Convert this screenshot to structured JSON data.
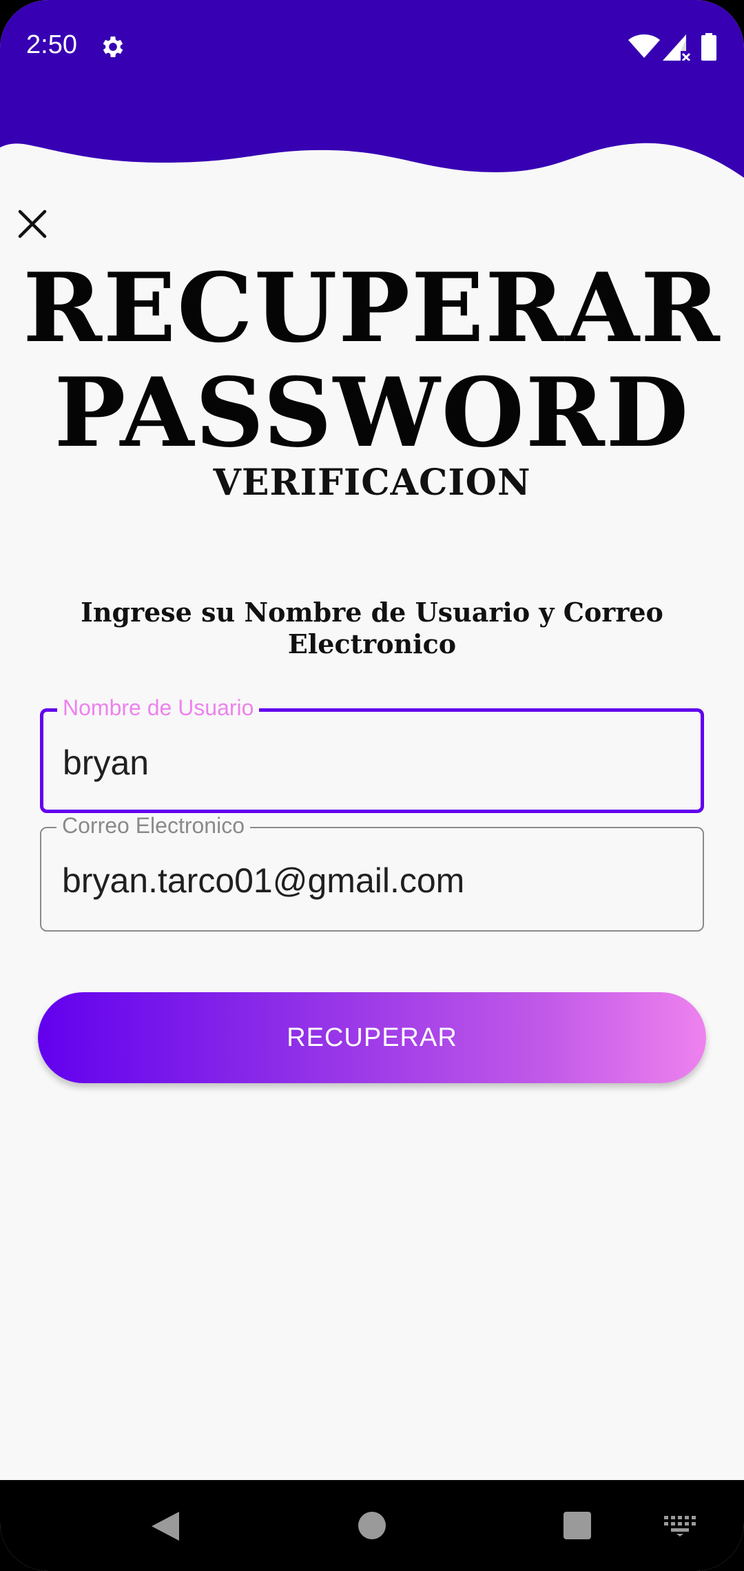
{
  "status_bar": {
    "time": "2:50",
    "icons": [
      "gear-icon",
      "wifi-icon",
      "signal-icon",
      "battery-icon"
    ]
  },
  "header": {
    "wave_color": "#3700B3"
  },
  "close_icon": "close-icon",
  "title": {
    "line1": "RECUPERAR",
    "line2": "PASSWORD",
    "subtitle": "VERIFICACION"
  },
  "instruction": "Ingrese su Nombre de Usuario y Correo Electronico",
  "form": {
    "username": {
      "label": "Nombre de Usuario",
      "value": "bryan"
    },
    "email": {
      "label": "Correo Electronico",
      "value": "bryan.tarco01@gmail.com"
    },
    "submit_label": "RECUPERAR"
  },
  "colors": {
    "primary": "#6200EE",
    "accent": "#EE82EE",
    "header": "#3700B3",
    "background": "#F8F8F8"
  },
  "nav_bar": {
    "icons": [
      "back-icon",
      "home-icon",
      "recents-icon",
      "keyboard-icon"
    ]
  }
}
